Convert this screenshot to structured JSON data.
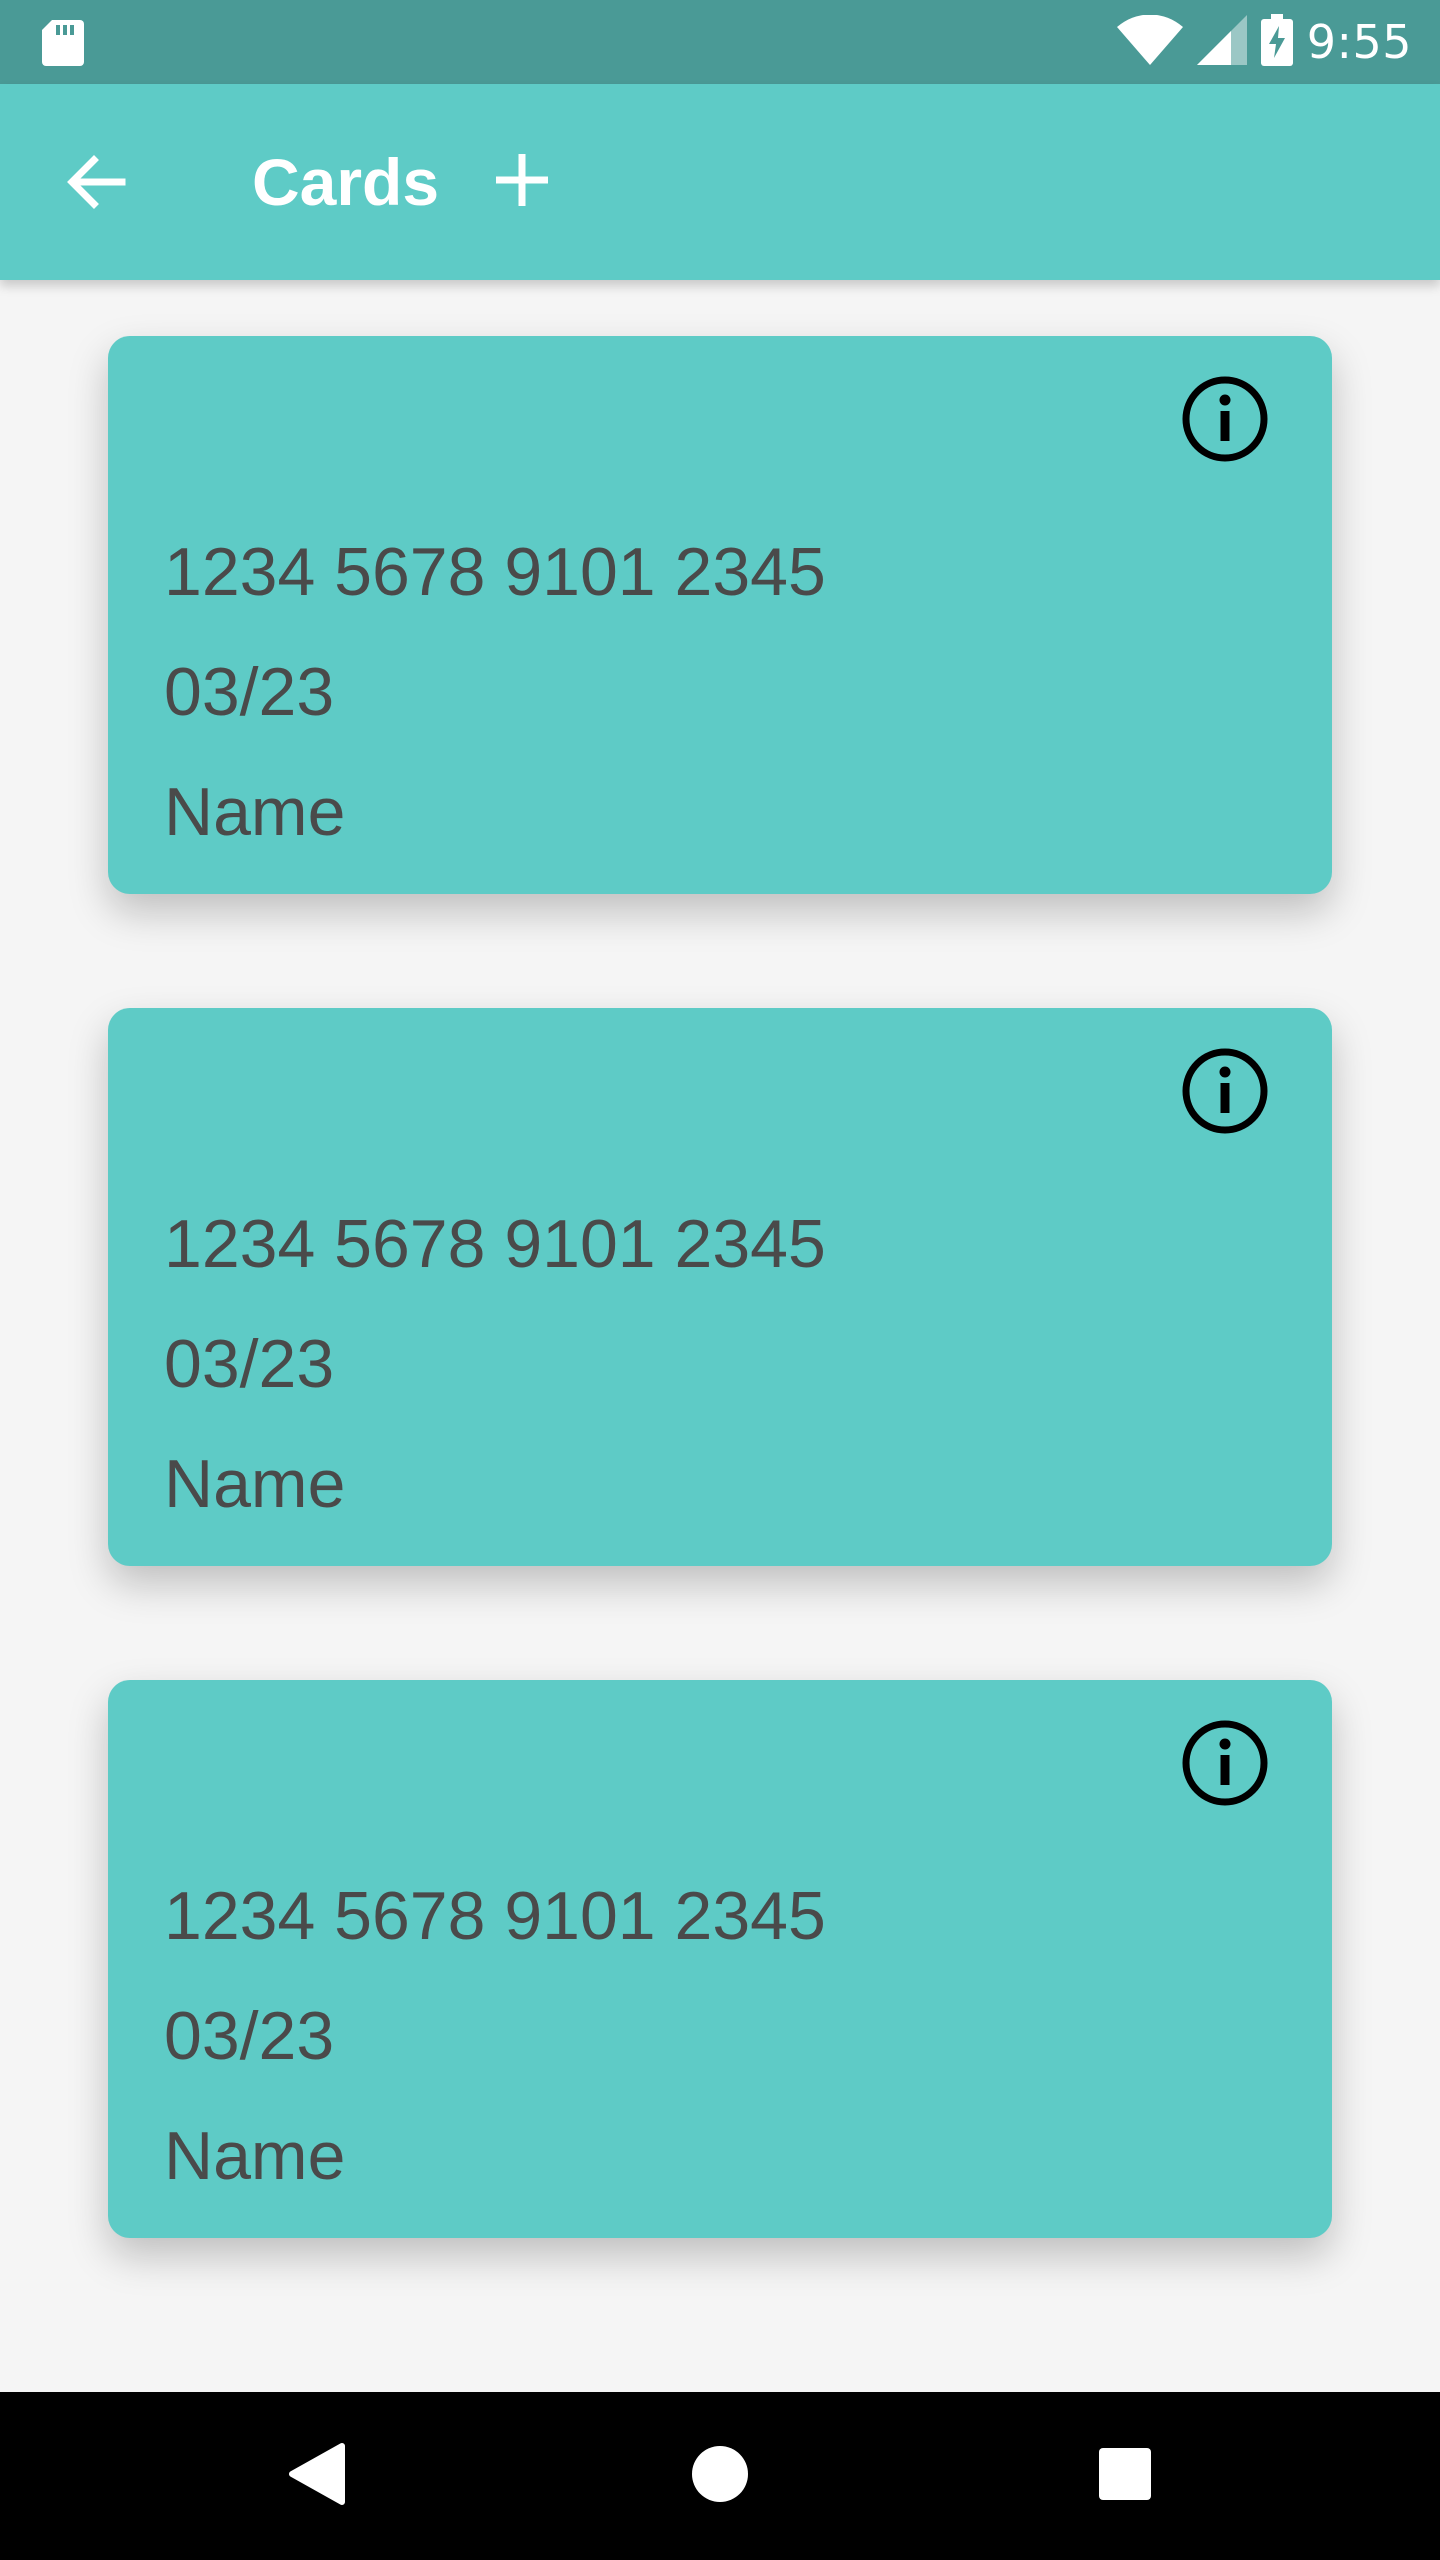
{
  "status_bar": {
    "time": "9:55",
    "icons": [
      "sd-card-icon",
      "wifi-icon",
      "signal-icon",
      "battery-charging-icon"
    ]
  },
  "app_bar": {
    "title": "Cards",
    "back_icon": "arrow-back-icon",
    "add_icon": "plus-icon"
  },
  "cards": [
    {
      "number": "1234 5678 9101 2345",
      "expiry": "03/23",
      "name": "Name",
      "icon": "info-icon"
    },
    {
      "number": "1234 5678 9101 2345",
      "expiry": "03/23",
      "name": "Name",
      "icon": "info-icon"
    },
    {
      "number": "1234 5678 9101 2345",
      "expiry": "03/23",
      "name": "Name",
      "icon": "info-icon"
    }
  ],
  "nav_bar": {
    "icons": [
      "back-triangle-icon",
      "home-circle-icon",
      "recents-square-icon"
    ]
  },
  "colors": {
    "status_bar": "#4a9a96",
    "app_bar": "#5ecbc6",
    "card": "#5ecbc6",
    "background": "#f5f5f5",
    "card_text": "#4a4a4a",
    "nav_bar": "#000000"
  }
}
